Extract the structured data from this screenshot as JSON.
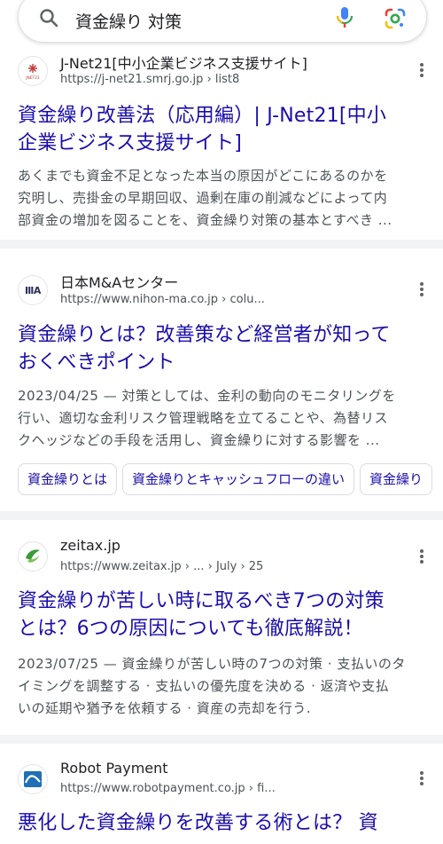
{
  "search": {
    "query": "資金繰り 対策"
  },
  "results": [
    {
      "site_name": "J-Net21[中小企業ビジネス支援サイト]",
      "url": "https://j-net21.smrj.go.jp",
      "url_path": " › list8",
      "favicon_text": "JNET21",
      "title_line1": "資金繰り改善法（応用編）| J-Net21[中小",
      "title_line2": "企業ビジネス支援サイト]",
      "snippet_lines": [
        "あくまでも資金不足となった本当の原因がどこにあるのかを",
        "究明し、売掛金の早期回収、過剰在庫の削減などによって内",
        "部資金の増加を図ることを、資金繰り対策の基本とすべき ..."
      ]
    },
    {
      "site_name": "日本M&Aセンター",
      "url": "https://www.nihon-ma.co.jp",
      "url_path": " › colu...",
      "favicon_text": "ⅢA",
      "title_line1": "資金繰りとは？改善策など経営者が知って",
      "title_line2": "おくべきポイント",
      "snippet_lines": [
        "2023/04/25 — 対策としては、金利の動向のモニタリングを",
        "行い、適切な金利リスク管理戦略を立てることや、為替リス",
        "クヘッジなどの手段を活用し、資金繰りに対する影響を ..."
      ],
      "chips": [
        "資金繰りとは",
        "資金繰りとキャッシュフローの違い",
        "資金繰り"
      ]
    },
    {
      "site_name": "zeitax.jp",
      "url": "https://www.zeitax.jp",
      "url_path": " › ... › July › 25",
      "title_line1": "資金繰りが苦しい時に取るべき7つの対策",
      "title_line2": "とは？6つの原因についても徹底解説！",
      "snippet_lines": [
        "2023/07/25 — 資金繰りが苦しい時の7つの対策 · 支払いのタ",
        "イミングを調整する · 支払いの優先度を決める · 返済や支払",
        "いの延期や猶予を依頼する · 資産の売却を行う."
      ]
    },
    {
      "site_name": "Robot Payment",
      "url": "https://www.robotpayment.co.jp",
      "url_path": " › fi...",
      "title_line1": "悪化した資金繰りを改善する術とは？ 資"
    }
  ],
  "colors": {
    "link": "#1a0dab",
    "snippet": "#4d5156",
    "separator": "#f1f3f4"
  }
}
